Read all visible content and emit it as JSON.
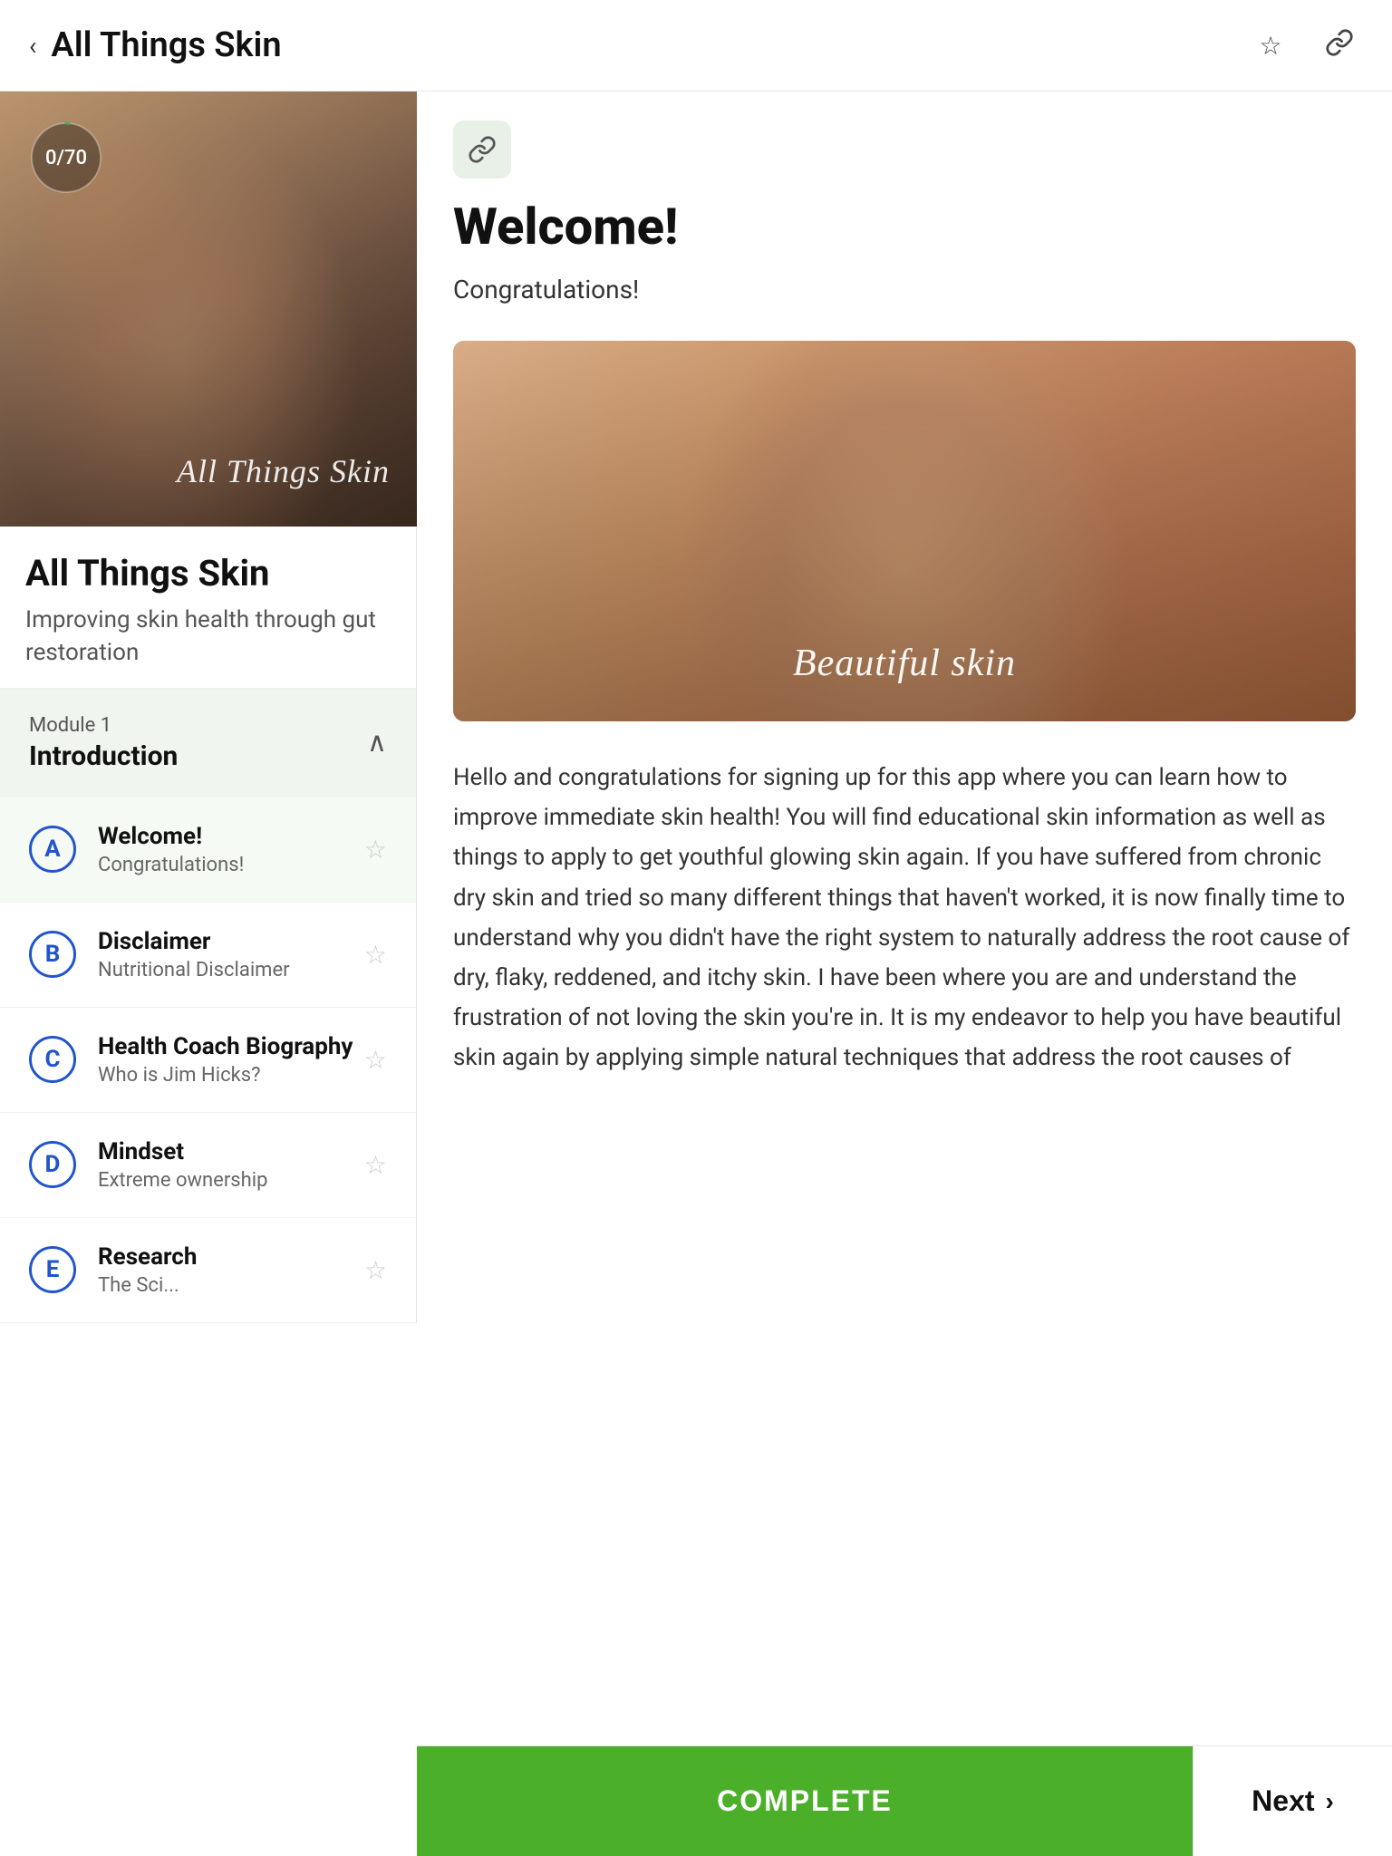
{
  "header": {
    "title": "All Things Skin",
    "back_label": "‹",
    "bookmark_icon": "☆",
    "share_icon": "🔗"
  },
  "left": {
    "course_title": "All Things Skin",
    "course_subtitle": "Improving skin health through gut restoration",
    "progress": {
      "current": 0,
      "total": 70,
      "label": "0/70"
    },
    "watermark": "All Things Skin",
    "module": {
      "label": "Module 1",
      "name": "Introduction"
    },
    "lessons": [
      {
        "letter": "A",
        "title": "Welcome!",
        "subtitle": "Congratulations!",
        "active": true
      },
      {
        "letter": "B",
        "title": "Disclaimer",
        "subtitle": "Nutritional Disclaimer",
        "active": false
      },
      {
        "letter": "C",
        "title": "Health Coach Biography",
        "subtitle": "Who is Jim Hicks?",
        "active": false
      },
      {
        "letter": "D",
        "title": "Mindset",
        "subtitle": "Extreme ownership",
        "active": false
      },
      {
        "letter": "E",
        "title": "Research",
        "subtitle": "The Sci...",
        "active": false
      }
    ]
  },
  "right": {
    "link_badge": "🔗",
    "welcome_title": "Welcome!",
    "congratulations": "Congratulations!",
    "skin_image_text": "Beautiful skin",
    "body_text": "Hello and congratulations for signing up for this app where you can learn how to improve immediate skin health! You will find educational skin information as well as things to apply to get youthful glowing skin again. If you have suffered from chronic dry skin and tried so many different things that haven't worked, it is now finally time to understand why you didn't have the right system to naturally address the root cause of dry, flaky, reddened, and itchy skin. I have been where you are and understand the frustration of not loving the skin you're in. It is my endeavor to help you have beautiful skin again by applying simple natural techniques that address the root causes of"
  },
  "buttons": {
    "complete_label": "COMPLETE",
    "next_label": "Next"
  }
}
